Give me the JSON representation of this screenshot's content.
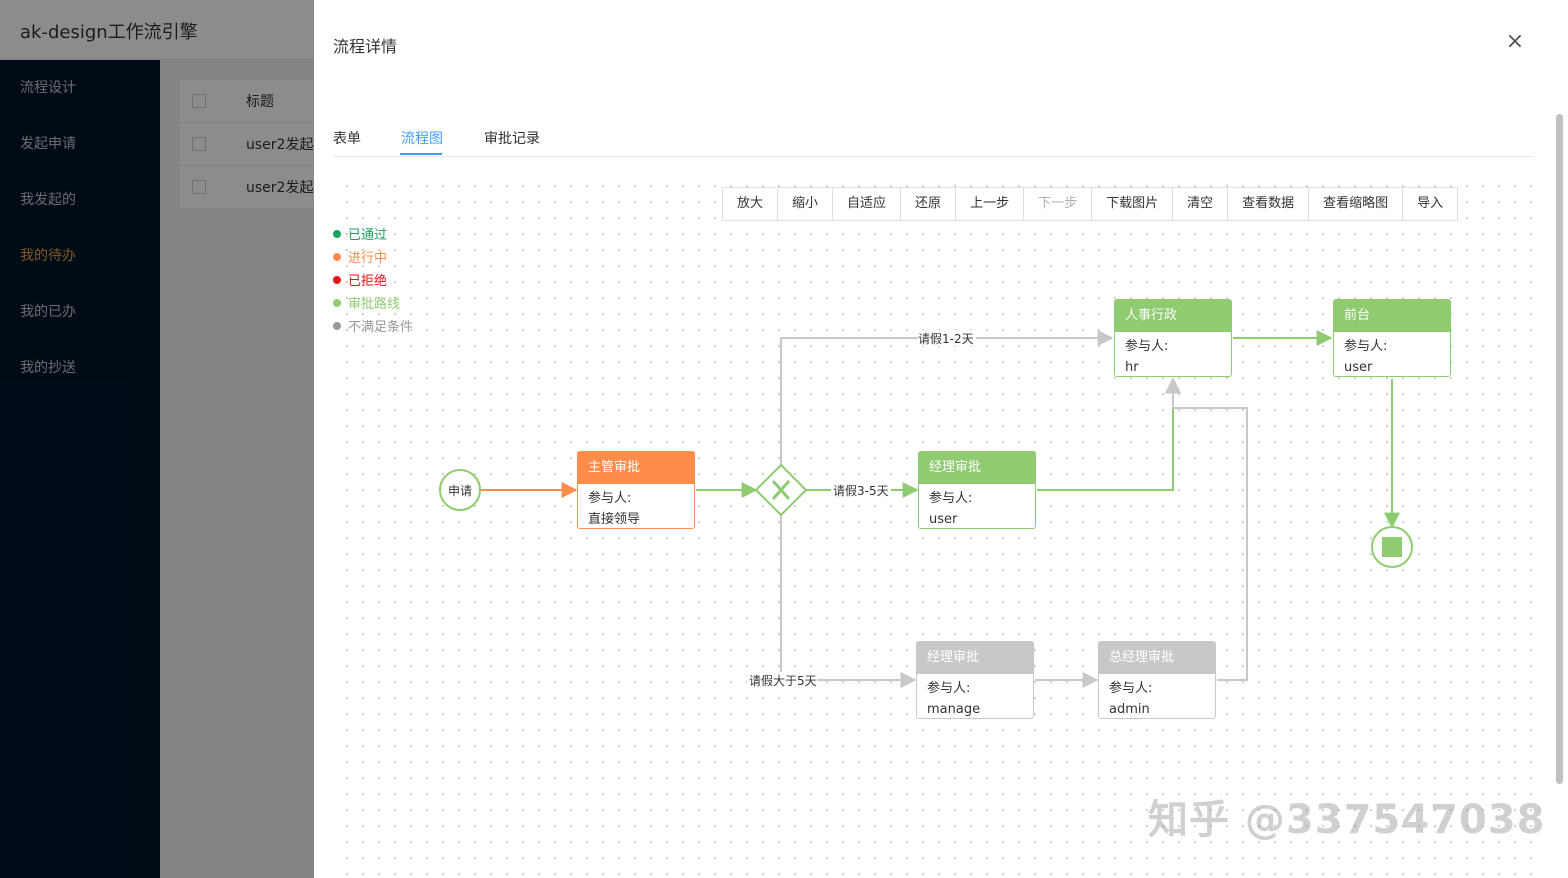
{
  "app": {
    "title": "ak-design工作流引擎"
  },
  "sidebar": {
    "items": [
      {
        "label": "流程设计"
      },
      {
        "label": "发起申请"
      },
      {
        "label": "我发起的"
      },
      {
        "label": "我的待办"
      },
      {
        "label": "我的已办"
      },
      {
        "label": "我的抄送"
      }
    ]
  },
  "table": {
    "header": "标题",
    "rows": [
      "user2发起",
      "user2发起"
    ]
  },
  "drawer": {
    "title": "流程详情",
    "close": "×"
  },
  "tabs": [
    {
      "label": "表单"
    },
    {
      "label": "流程图"
    },
    {
      "label": "审批记录"
    }
  ],
  "toolbar": [
    "放大",
    "缩小",
    "自适应",
    "还原",
    "上一步",
    "下一步",
    "下载图片",
    "清空",
    "查看数据",
    "查看缩略图",
    "导入"
  ],
  "legend": [
    {
      "label": "已通过",
      "color": "#1aa260"
    },
    {
      "label": "进行中",
      "color": "#ff8c4a"
    },
    {
      "label": "已拒绝",
      "color": "#e51515"
    },
    {
      "label": "审批路线",
      "color": "#8fcb70"
    },
    {
      "label": "不满足条件",
      "color": "#999999"
    }
  ],
  "colors": {
    "done": "#8fcb70",
    "current": "#ff8c4a",
    "pending": "#c8c8c8"
  },
  "flow": {
    "start": "申请",
    "participant_label": "参与人:",
    "nodes": {
      "supervisor": {
        "title": "主管审批",
        "user": "直接领导"
      },
      "hr": {
        "title": "人事行政",
        "user": "hr"
      },
      "frontdesk": {
        "title": "前台",
        "user": "user"
      },
      "manager": {
        "title": "经理审批",
        "user": "user"
      },
      "manager2": {
        "title": "经理审批",
        "user": "manage"
      },
      "gm": {
        "title": "总经理审批",
        "user": "admin"
      }
    },
    "edges": {
      "e12": "请假1-2天",
      "e35": "请假3-5天",
      "e5plus": "请假大于5天"
    }
  },
  "watermark": "知乎 @337547038"
}
